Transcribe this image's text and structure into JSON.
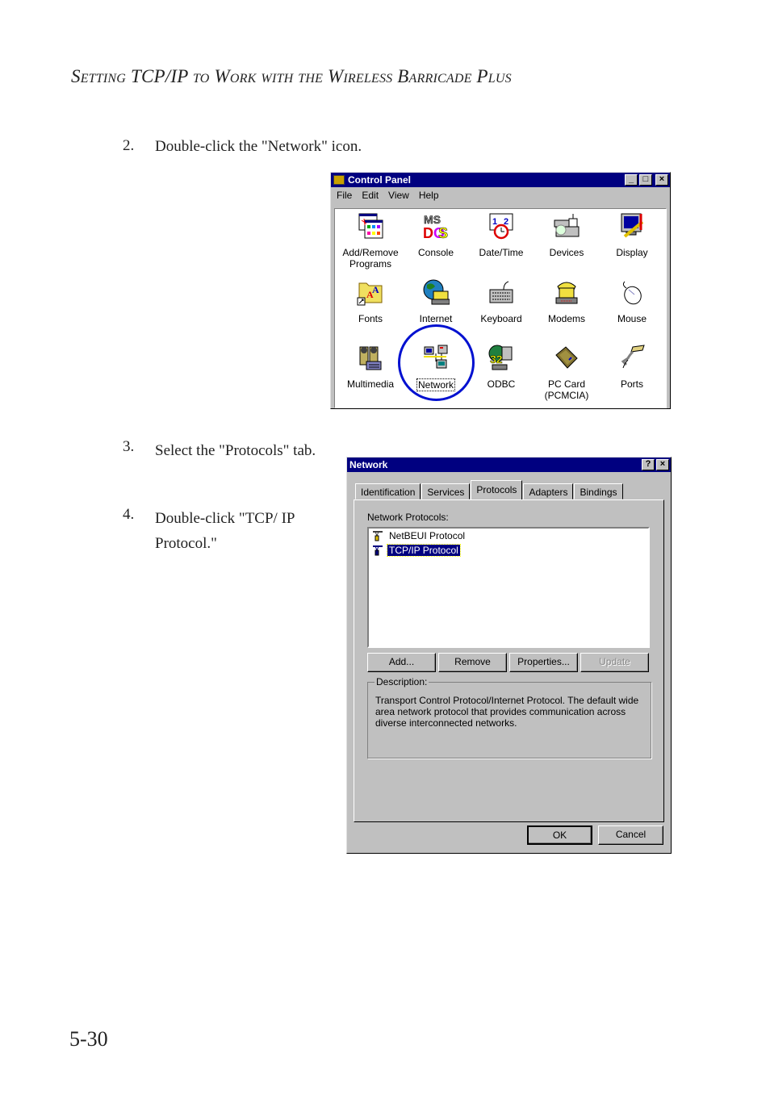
{
  "running_head": "Setting TCP/IP to Work with the Wireless Barricade Plus",
  "page_number": "5-30",
  "steps": [
    {
      "num": "2.",
      "text": "Double-click the \"Network\" icon."
    },
    {
      "num": "3.",
      "text": "Select the \"Protocols\" tab."
    },
    {
      "num": "4.",
      "text": "Double-click \"TCP/ IP Protocol.\""
    }
  ],
  "control_panel": {
    "title": "Control Panel",
    "menu": [
      "File",
      "Edit",
      "View",
      "Help"
    ],
    "items": [
      {
        "label": "Add/Remove Programs",
        "icon": "add-remove-programs-icon"
      },
      {
        "label": "Console",
        "icon": "console-icon"
      },
      {
        "label": "Date/Time",
        "icon": "date-time-icon"
      },
      {
        "label": "Devices",
        "icon": "devices-icon"
      },
      {
        "label": "Display",
        "icon": "display-icon"
      },
      {
        "label": "Fonts",
        "icon": "fonts-icon"
      },
      {
        "label": "Internet",
        "icon": "internet-icon"
      },
      {
        "label": "Keyboard",
        "icon": "keyboard-icon"
      },
      {
        "label": "Modems",
        "icon": "modems-icon"
      },
      {
        "label": "Mouse",
        "icon": "mouse-icon"
      },
      {
        "label": "Multimedia",
        "icon": "multimedia-icon"
      },
      {
        "label": "Network",
        "icon": "network-icon"
      },
      {
        "label": "ODBC",
        "icon": "odbc-icon"
      },
      {
        "label": "PC Card (PCMCIA)",
        "icon": "pc-card-icon"
      },
      {
        "label": "Ports",
        "icon": "ports-icon"
      }
    ]
  },
  "network_dialog": {
    "title": "Network",
    "tabs": [
      "Identification",
      "Services",
      "Protocols",
      "Adapters",
      "Bindings"
    ],
    "active_tab": "Protocols",
    "list_label": "Network Protocols:",
    "protocols": [
      {
        "label": "NetBEUI Protocol",
        "selected": false
      },
      {
        "label": "TCP/IP Protocol",
        "selected": true
      }
    ],
    "buttons": {
      "add": "Add...",
      "remove": "Remove",
      "properties": "Properties...",
      "update": "Update"
    },
    "description_label": "Description:",
    "description_text": "Transport Control Protocol/Internet Protocol. The default wide area network protocol that provides communication across diverse interconnected networks.",
    "ok": "OK",
    "cancel": "Cancel"
  }
}
